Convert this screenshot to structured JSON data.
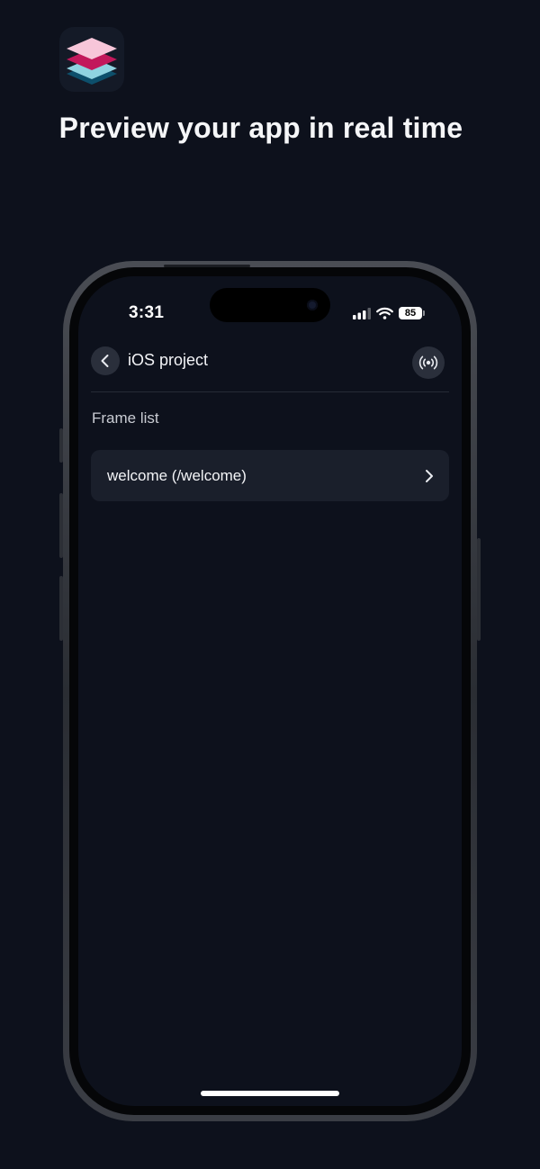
{
  "headline": "Preview your app in real time",
  "logo": {
    "icon": "layers-stack-icon",
    "colors": [
      "#f7c6d9",
      "#c2185b",
      "#8fd3e0",
      "#0d4f6b"
    ]
  },
  "phone": {
    "status_bar": {
      "time": "3:31",
      "battery": "85",
      "icons": [
        "signal-icon",
        "wifi-icon",
        "battery-icon"
      ]
    },
    "nav": {
      "back_icon": "chevron-left-icon",
      "title": "iOS project",
      "live_icon": "broadcast-icon"
    },
    "section_label": "Frame list",
    "frames": [
      {
        "label": "welcome (/welcome)",
        "icon": "chevron-right-icon"
      }
    ]
  },
  "colors": {
    "background": "#0d111c",
    "card": "#1a1f2b",
    "button": "#2a2f3b"
  }
}
